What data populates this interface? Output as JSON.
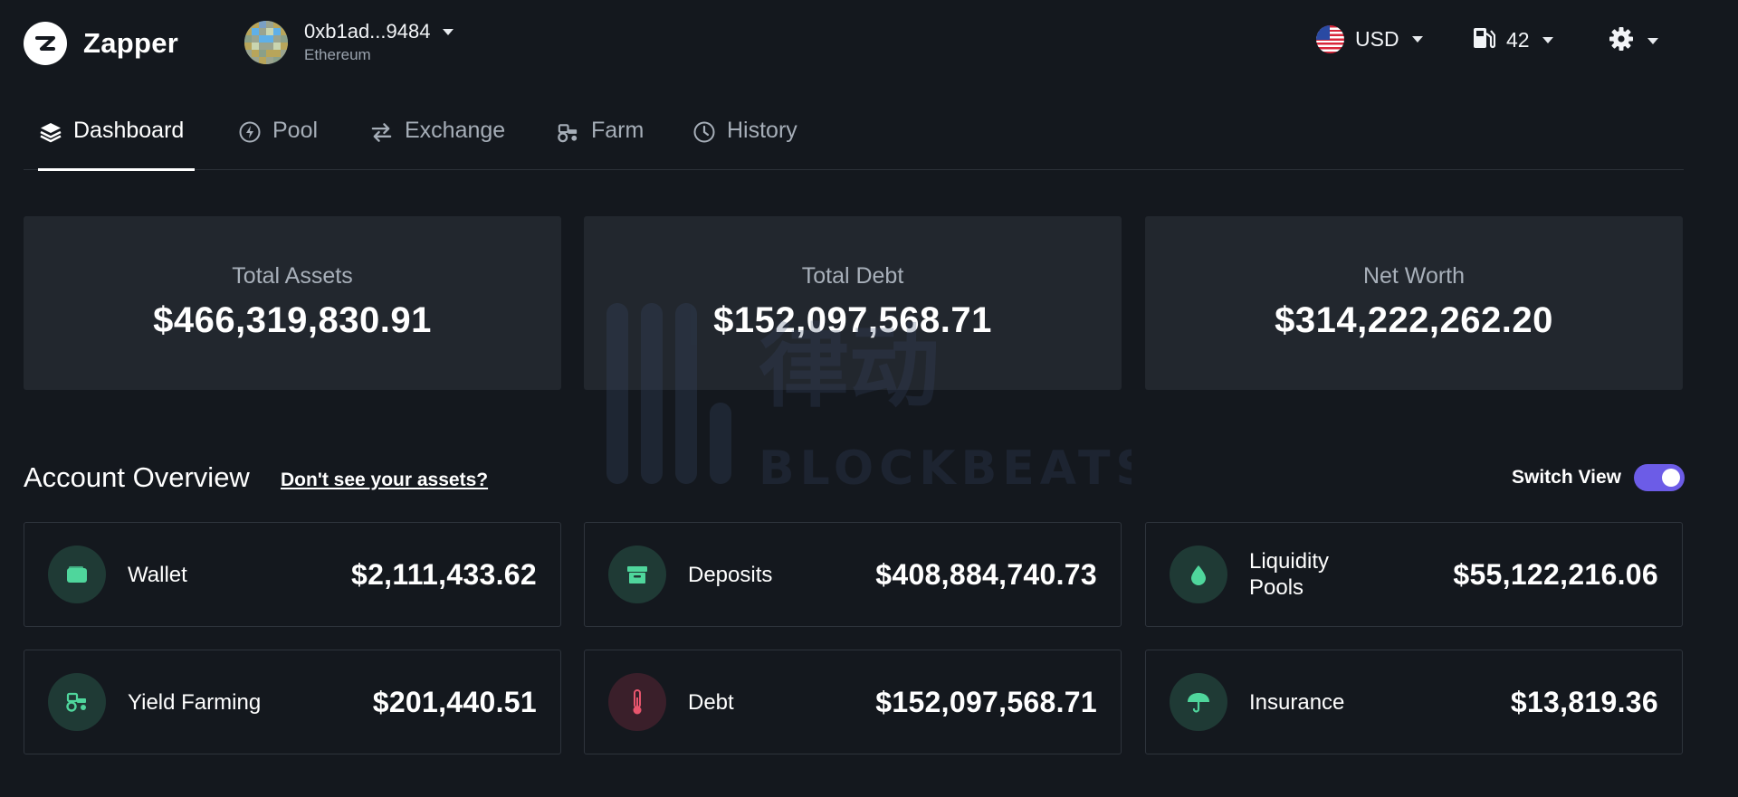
{
  "brand": {
    "name": "Zapper"
  },
  "wallet": {
    "address": "0xb1ad...9484",
    "network": "Ethereum"
  },
  "top_controls": {
    "currency": "USD",
    "gas": "42"
  },
  "tabs": [
    {
      "label": "Dashboard",
      "icon": "layers-icon",
      "active": true
    },
    {
      "label": "Pool",
      "icon": "bolt-icon",
      "active": false
    },
    {
      "label": "Exchange",
      "icon": "swap-arrows-icon",
      "active": false
    },
    {
      "label": "Farm",
      "icon": "tractor-icon",
      "active": false
    },
    {
      "label": "History",
      "icon": "clock-icon",
      "active": false
    }
  ],
  "summary": [
    {
      "title": "Total Assets",
      "value": "$466,319,830.91"
    },
    {
      "title": "Total Debt",
      "value": "$152,097,568.71"
    },
    {
      "title": "Net Worth",
      "value": "$314,222,262.20"
    }
  ],
  "overview": {
    "heading": "Account Overview",
    "link": "Don't see your assets?",
    "switch_label": "Switch View",
    "switch_on": true
  },
  "assets": [
    {
      "label": "Wallet",
      "value": "$2,111,433.62",
      "icon": "wallet-icon"
    },
    {
      "label": "Deposits",
      "value": "$408,884,740.73",
      "icon": "archive-box-icon"
    },
    {
      "label": "Liquidity Pools",
      "value": "$55,122,216.06",
      "icon": "droplet-icon"
    },
    {
      "label": "Yield Farming",
      "value": "$201,440.51",
      "icon": "tractor-icon"
    },
    {
      "label": "Debt",
      "value": "$152,097,568.71",
      "icon": "thermometer-icon"
    },
    {
      "label": "Insurance",
      "value": "$13,819.36",
      "icon": "umbrella-icon"
    }
  ],
  "watermark": {
    "text": "律动 BLOCKBEATS"
  },
  "colors": {
    "background": "#14181e",
    "card": "#22272e",
    "accent_green": "#4fd69c",
    "accent_red": "#e8556d",
    "toggle": "#6c5ce7"
  }
}
